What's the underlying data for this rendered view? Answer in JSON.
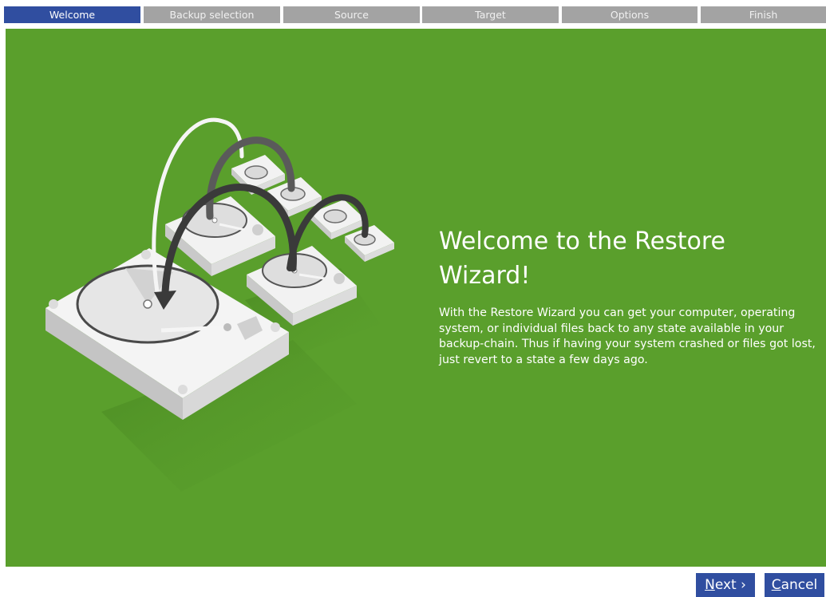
{
  "steps": [
    {
      "label": "Welcome",
      "active": true
    },
    {
      "label": "Backup selection",
      "active": false
    },
    {
      "label": "Source",
      "active": false
    },
    {
      "label": "Target",
      "active": false
    },
    {
      "label": "Options",
      "active": false
    },
    {
      "label": "Finish",
      "active": false
    }
  ],
  "main": {
    "title": "Welcome to the Restore Wizard!",
    "description": "With the Restore Wizard you can get your computer, operating system, or individual files back to any state available in your backup-chain. Thus if having your system crashed or files got lost, just revert to a state a few days ago."
  },
  "buttons": {
    "next": {
      "accel": "N",
      "rest": "ext ›"
    },
    "cancel": {
      "accel": "C",
      "rest": "ancel"
    }
  },
  "colors": {
    "panel_bg": "#5a9f2c",
    "step_active": "#304ea0",
    "step_inactive": "#a3a3a3",
    "button_bg": "#304ea0"
  },
  "icons": {
    "illustration": "hard-drives-restore-illustration"
  }
}
